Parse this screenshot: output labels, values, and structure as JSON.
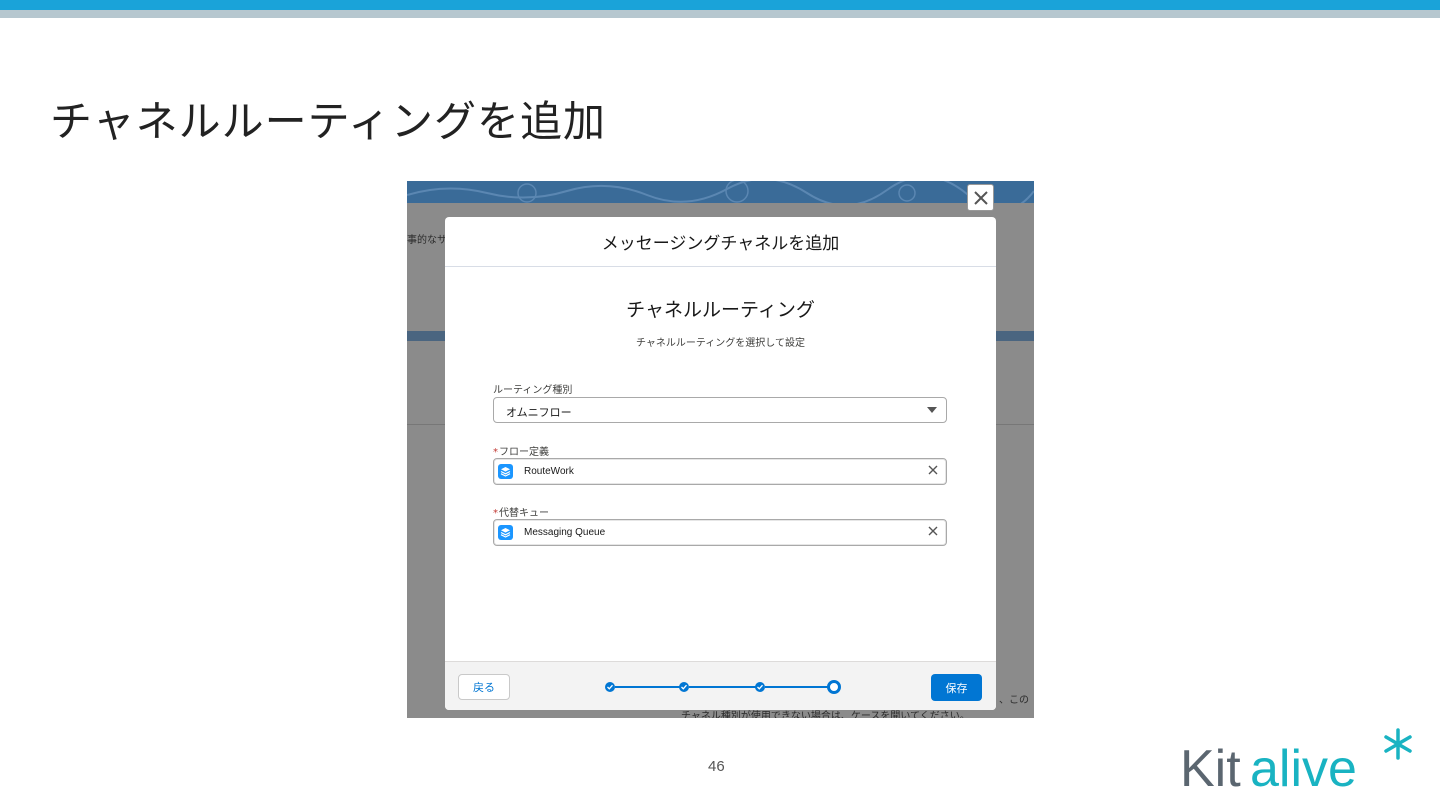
{
  "slide": {
    "title": "チャネルルーティングを追加",
    "page_number": "46",
    "logo_text": "Kitalive"
  },
  "background": {
    "left_fragment": "事的なサ",
    "right_fragment": "、この",
    "bottom_fragment": "チャネル種別が使用できない場合は、ケースを開いてください。"
  },
  "modal": {
    "header_title": "メッセージングチャネルを追加",
    "section_title": "チャネルルーティング",
    "section_subtitle": "チャネルルーティングを選択して設定",
    "routing_type": {
      "label": "ルーティング種別",
      "value": "オムニフロー"
    },
    "flow_definition": {
      "required_mark": "*",
      "label": "フロー定義",
      "value": "RouteWork"
    },
    "fallback_queue": {
      "required_mark": "*",
      "label": "代替キュー",
      "value": "Messaging Queue"
    },
    "footer": {
      "back_label": "戻る",
      "save_label": "保存",
      "progress": {
        "total_steps": 4,
        "current_step": 4
      }
    }
  },
  "colors": {
    "accent": "#0176d3",
    "top_bar": "#1aa3d9",
    "logo_gray": "#5b6670",
    "logo_teal": "#19b3c2"
  }
}
